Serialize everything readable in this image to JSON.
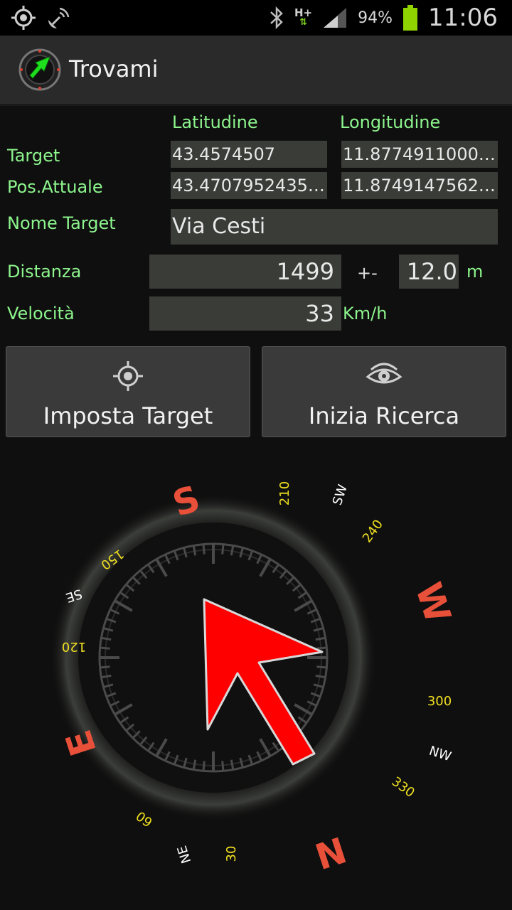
{
  "status_bar": {
    "battery_pct": "94%",
    "time": "11:06",
    "network": "H+",
    "icons": [
      "gps-icon",
      "satellite-icon",
      "bluetooth-icon",
      "network-hplus-icon",
      "signal-icon",
      "battery-icon"
    ],
    "battery_color": "#8fd400"
  },
  "app": {
    "title": "Trovami"
  },
  "coords": {
    "col_lat": "Latitudine",
    "col_lon": "Longitudine",
    "target_label": "Target",
    "target_lat": "43.4574507",
    "target_lon": "11.8774911000…",
    "current_label": "Pos.Attuale",
    "current_lat": "43.4707952435…",
    "current_lon": "11.8749147562…"
  },
  "target_name": {
    "label": "Nome Target",
    "value": "Via Cesti"
  },
  "distance": {
    "label": "Distanza",
    "value": "1499",
    "plus_minus": "+-",
    "accuracy": "12.0",
    "unit": "m"
  },
  "speed": {
    "label": "Velocità",
    "value": "33",
    "unit": "Km/h"
  },
  "buttons": {
    "set_target": {
      "label": "Imposta Target",
      "icon": "crosshair-icon"
    },
    "start_search": {
      "label": "Inizia Ricerca",
      "icon": "eye-icon"
    }
  },
  "compass": {
    "cardinals": {
      "N": "N",
      "S": "S",
      "E": "E",
      "W": "W"
    },
    "intercardinals": {
      "NE": "NE",
      "SE": "SE",
      "SW": "SW",
      "NW": "NW"
    },
    "degrees": {
      "d30": "30",
      "d60": "60",
      "d120": "120",
      "d150": "150",
      "d210": "210",
      "d240": "240",
      "d300": "300",
      "d330": "330"
    },
    "colors": {
      "cardinal": "#e8503a",
      "degree": "#f0e020",
      "intercardinal": "#ffffff",
      "arrow": "#ff0000"
    }
  },
  "colors": {
    "label_green": "#8df58d",
    "field_bg": "#3a3c38"
  }
}
